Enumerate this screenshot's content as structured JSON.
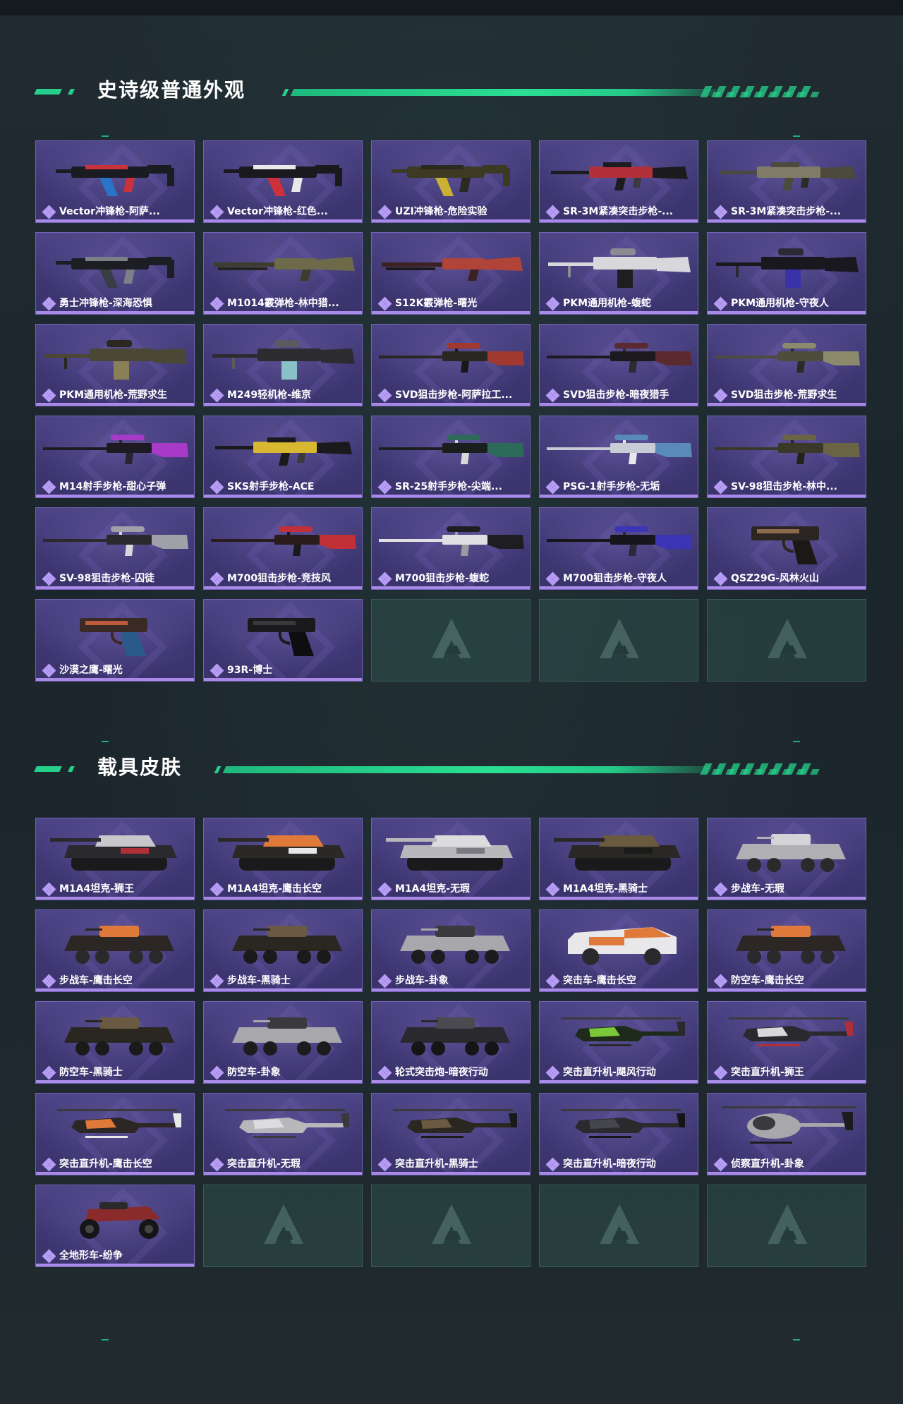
{
  "sections": [
    {
      "title": "史诗级普通外观",
      "items": [
        {
          "label": "Vector冲锋枪-阿萨...",
          "kind": "smg",
          "palette": [
            "#1b1c22",
            "#2a74c8",
            "#c8333b"
          ]
        },
        {
          "label": "Vector冲锋枪-红色...",
          "kind": "smg",
          "palette": [
            "#1a1a1e",
            "#d0303a",
            "#e8e8e8"
          ]
        },
        {
          "label": "UZI冲锋枪-危险实验",
          "kind": "smg",
          "palette": [
            "#3c3a22",
            "#c9b233",
            "#2a2a20"
          ]
        },
        {
          "label": "SR-3M紧凑突击步枪-...",
          "kind": "rifle",
          "palette": [
            "#1c1c20",
            "#b2303a",
            "#3a3a40"
          ]
        },
        {
          "label": "SR-3M紧凑突击步枪-...",
          "kind": "rifle",
          "palette": [
            "#4b4a3c",
            "#807c68",
            "#2c2c26"
          ]
        },
        {
          "label": "勇士冲锋枪-深海恐惧",
          "kind": "smg",
          "palette": [
            "#1d1e24",
            "#3a3c46",
            "#7c7e88"
          ]
        },
        {
          "label": "M1014霰弹枪-林中猎...",
          "kind": "shotgun",
          "palette": [
            "#3e3c2c",
            "#6c6a48",
            "#23231c"
          ]
        },
        {
          "label": "S12K霰弹枪-曙光",
          "kind": "shotgun",
          "palette": [
            "#3a2222",
            "#b04438",
            "#1e1a1a"
          ]
        },
        {
          "label": "PKM通用机枪-蝮蛇",
          "kind": "mg",
          "palette": [
            "#d8d8dc",
            "#1e1e22",
            "#8a8a90"
          ]
        },
        {
          "label": "PKM通用机枪-守夜人",
          "kind": "mg",
          "palette": [
            "#18181e",
            "#3a32a8",
            "#2a2a34"
          ]
        },
        {
          "label": "PKM通用机枪-荒野求生",
          "kind": "mg",
          "palette": [
            "#4a4734",
            "#8a8058",
            "#2a281e"
          ]
        },
        {
          "label": "M249轻机枪-维京",
          "kind": "mg",
          "palette": [
            "#2c2c30",
            "#8ac0c8",
            "#5a5a60"
          ]
        },
        {
          "label": "SVD狙击步枪-阿萨拉工...",
          "kind": "sniper",
          "palette": [
            "#2a2622",
            "#a03a30",
            "#1a1816"
          ]
        },
        {
          "label": "SVD狙击步枪-暗夜猎手",
          "kind": "sniper",
          "palette": [
            "#1c1a1e",
            "#5a2a2e",
            "#2e2a30"
          ]
        },
        {
          "label": "SVD狙击步枪-荒野求生",
          "kind": "sniper",
          "palette": [
            "#4e4c3c",
            "#8c8a6c",
            "#2a2a22"
          ]
        },
        {
          "label": "M14射手步枪-甜心子弹",
          "kind": "sniper",
          "palette": [
            "#1e1a22",
            "#a83ac8",
            "#2a2430"
          ]
        },
        {
          "label": "SKS射手步枪-ACE",
          "kind": "rifle",
          "palette": [
            "#1a1a1c",
            "#d8b830",
            "#3a3a3e"
          ]
        },
        {
          "label": "SR-25射手步枪-尖端...",
          "kind": "sniper",
          "palette": [
            "#1a1e1c",
            "#2e6a5a",
            "#d8d8d8"
          ]
        },
        {
          "label": "PSG-1射手步枪-无垢",
          "kind": "sniper",
          "palette": [
            "#c8ccd4",
            "#5a8ab8",
            "#e8e8ec"
          ]
        },
        {
          "label": "SV-98狙击步枪-林中...",
          "kind": "sniper",
          "palette": [
            "#3a3828",
            "#6a6444",
            "#24221a"
          ]
        },
        {
          "label": "SV-98狙击步枪-囚徒",
          "kind": "sniper",
          "palette": [
            "#2a2a2e",
            "#a0a0a8",
            "#d8d8dc"
          ]
        },
        {
          "label": "M700狙击步枪-竞技风",
          "kind": "sniper",
          "palette": [
            "#2a1c1e",
            "#c03036",
            "#1a1a1c"
          ]
        },
        {
          "label": "M700狙击步枪-蝮蛇",
          "kind": "sniper",
          "palette": [
            "#e0e0e4",
            "#1e1e22",
            "#9a9aa0"
          ]
        },
        {
          "label": "M700狙击步枪-守夜人",
          "kind": "sniper",
          "palette": [
            "#16161c",
            "#3b34b4",
            "#2c2a38"
          ]
        },
        {
          "label": "QSZ29G-风林火山",
          "kind": "pistol",
          "palette": [
            "#2c2622",
            "#8a6a4a",
            "#1c1816"
          ]
        },
        {
          "label": "沙漠之鹰-曙光",
          "kind": "pistol",
          "palette": [
            "#3a2a26",
            "#c05a3e",
            "#2a5a8a"
          ]
        },
        {
          "label": "93R-博士",
          "kind": "pistol",
          "palette": [
            "#1a1a1c",
            "#3a3a3e",
            "#0e0e10"
          ]
        }
      ],
      "empty_slots": 3
    },
    {
      "title": "载具皮肤",
      "items": [
        {
          "label": "M1A4坦克-狮王",
          "kind": "tank",
          "palette": [
            "#2a2a2e",
            "#c8c8cc",
            "#b0303a"
          ]
        },
        {
          "label": "M1A4坦克-鹰击长空",
          "kind": "tank",
          "palette": [
            "#2c2826",
            "#e07a3a",
            "#e8e8e8"
          ]
        },
        {
          "label": "M1A4坦克-无瑕",
          "kind": "tank",
          "palette": [
            "#b8b8bc",
            "#dcdcdf",
            "#7a7a80"
          ]
        },
        {
          "label": "M1A4坦克-黑骑士",
          "kind": "tank",
          "palette": [
            "#2a2824",
            "#6a5a40",
            "#1a1a1a"
          ]
        },
        {
          "label": "步战车-无瑕",
          "kind": "apc",
          "palette": [
            "#b0b0b4",
            "#d4d4d8",
            "#2a2a2c"
          ]
        },
        {
          "label": "步战车-鹰击长空",
          "kind": "apc",
          "palette": [
            "#2c2624",
            "#e07a3a",
            "#2a2a2c"
          ]
        },
        {
          "label": "步战车-黑骑士",
          "kind": "apc",
          "palette": [
            "#2a2620",
            "#6a5a44",
            "#1a1a1a"
          ]
        },
        {
          "label": "步战车-卦象",
          "kind": "apc",
          "palette": [
            "#a8a8ac",
            "#3a3a3e",
            "#1c1c1e"
          ]
        },
        {
          "label": "突击车-鹰击长空",
          "kind": "truck",
          "palette": [
            "#e8e8ea",
            "#e07a3a",
            "#2a2a2c"
          ]
        },
        {
          "label": "防空车-鹰击长空",
          "kind": "apc",
          "palette": [
            "#2c2624",
            "#e07a3a",
            "#2a2a2c"
          ]
        },
        {
          "label": "防空车-黑骑士",
          "kind": "apc",
          "palette": [
            "#2a2620",
            "#6a5a44",
            "#1a1a1a"
          ]
        },
        {
          "label": "防空车-卦象",
          "kind": "apc",
          "palette": [
            "#a8a8ac",
            "#3a3a3e",
            "#1c1c1e"
          ]
        },
        {
          "label": "轮式突击炮-暗夜行动",
          "kind": "apc",
          "palette": [
            "#2a2a2e",
            "#4a4a50",
            "#151517"
          ]
        },
        {
          "label": "突击直升机-飓风行动",
          "kind": "heli",
          "palette": [
            "#1e2a1a",
            "#7ac83a",
            "#2a2a2c"
          ]
        },
        {
          "label": "突击直升机-狮王",
          "kind": "heli",
          "palette": [
            "#2a2a2e",
            "#d8d8dc",
            "#b0303a"
          ]
        },
        {
          "label": "突击直升机-鹰击长空",
          "kind": "heli",
          "palette": [
            "#2c2624",
            "#e07a3a",
            "#e8e8e8"
          ]
        },
        {
          "label": "突击直升机-无瑕",
          "kind": "heli",
          "palette": [
            "#b8b8bc",
            "#dcdcdf",
            "#3a3a3e"
          ]
        },
        {
          "label": "突击直升机-黑骑士",
          "kind": "heli",
          "palette": [
            "#2a2620",
            "#6a5a44",
            "#1a1a1a"
          ]
        },
        {
          "label": "突击直升机-暗夜行动",
          "kind": "heli",
          "palette": [
            "#2a2a2e",
            "#45454c",
            "#151517"
          ]
        },
        {
          "label": "侦察直升机-卦象",
          "kind": "heli2",
          "palette": [
            "#a8a8ac",
            "#3a3a3e",
            "#1c1c1e"
          ]
        },
        {
          "label": "全地形车-纷争",
          "kind": "atv",
          "palette": [
            "#2a2a2c",
            "#8a2a2a",
            "#151517"
          ]
        }
      ],
      "empty_slots": 4
    }
  ]
}
